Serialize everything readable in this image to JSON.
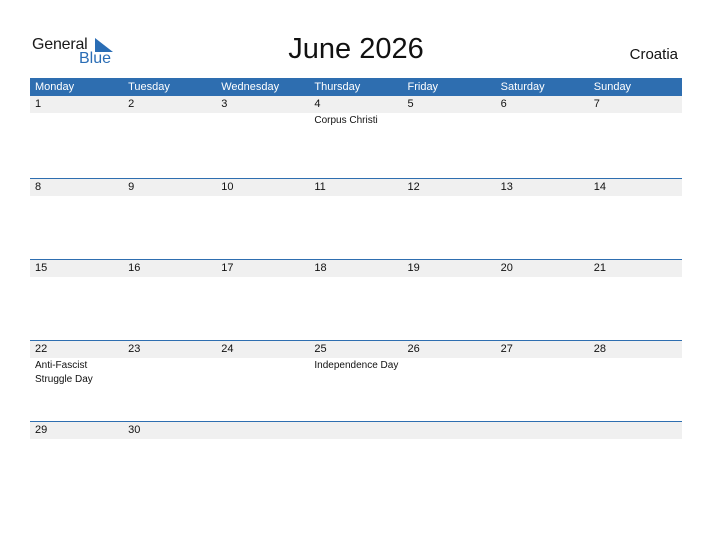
{
  "logo": {
    "general": "General",
    "blue": "Blue"
  },
  "title": "June 2026",
  "country": "Croatia",
  "colors": {
    "accent": "#2e6eb0",
    "date_strip": "#f0f0f0"
  },
  "weekdays": [
    "Monday",
    "Tuesday",
    "Wednesday",
    "Thursday",
    "Friday",
    "Saturday",
    "Sunday"
  ],
  "weeks": [
    {
      "dates": [
        "1",
        "2",
        "3",
        "4",
        "5",
        "6",
        "7"
      ],
      "events": [
        "",
        "",
        "",
        "Corpus Christi",
        "",
        "",
        ""
      ]
    },
    {
      "dates": [
        "8",
        "9",
        "10",
        "11",
        "12",
        "13",
        "14"
      ],
      "events": [
        "",
        "",
        "",
        "",
        "",
        "",
        ""
      ]
    },
    {
      "dates": [
        "15",
        "16",
        "17",
        "18",
        "19",
        "20",
        "21"
      ],
      "events": [
        "",
        "",
        "",
        "",
        "",
        "",
        ""
      ]
    },
    {
      "dates": [
        "22",
        "23",
        "24",
        "25",
        "26",
        "27",
        "28"
      ],
      "events": [
        "Anti-Fascist Struggle Day",
        "",
        "",
        "Independence Day",
        "",
        "",
        ""
      ]
    },
    {
      "dates": [
        "29",
        "30",
        "",
        "",
        "",
        "",
        ""
      ],
      "events": [
        "",
        "",
        "",
        "",
        "",
        "",
        ""
      ]
    }
  ]
}
